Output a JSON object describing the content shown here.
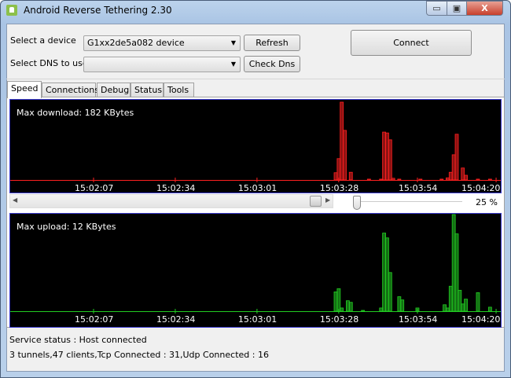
{
  "window": {
    "title": "Android Reverse Tethering 2.30",
    "minimize": "▭",
    "maximize": "▣",
    "close": "X"
  },
  "controls": {
    "device_label": "Select a device",
    "device_value": "G1xx2de5a082  device",
    "refresh": "Refresh",
    "dns_label": "Select DNS to use",
    "dns_value": "",
    "check_dns": "Check Dns",
    "connect": "Connect"
  },
  "tabs": [
    "Speed",
    "Connections",
    "Debug",
    "Status",
    "Tools"
  ],
  "zoom": {
    "value": 25,
    "label": "25 %"
  },
  "colors": {
    "download": "#ff2020",
    "upload": "#22cc22",
    "chart_bg": "#000000",
    "chart_border": "#3a3ad0"
  },
  "chart_data": [
    {
      "type": "bar",
      "title": "Max download: 182 KBytes",
      "ylabel": "KBytes",
      "ymax": 182,
      "x_unit": "seconds after 15:02:07",
      "ticks": [
        "15:02:07",
        "15:02:34",
        "15:03:01",
        "15:03:28",
        "15:03:54",
        "15:04:20"
      ],
      "tick_t": [
        0,
        27,
        54,
        81,
        107,
        133
      ],
      "bars": [
        {
          "t": 80,
          "v": 17
        },
        {
          "t": 81,
          "v": 50
        },
        {
          "t": 82,
          "v": 182
        },
        {
          "t": 83,
          "v": 116
        },
        {
          "t": 85,
          "v": 18
        },
        {
          "t": 91,
          "v": 2
        },
        {
          "t": 95,
          "v": 2
        },
        {
          "t": 96,
          "v": 112
        },
        {
          "t": 97,
          "v": 110
        },
        {
          "t": 98,
          "v": 94
        },
        {
          "t": 99,
          "v": 4
        },
        {
          "t": 101,
          "v": 2
        },
        {
          "t": 108,
          "v": 2
        },
        {
          "t": 115,
          "v": 2
        },
        {
          "t": 117,
          "v": 5
        },
        {
          "t": 118,
          "v": 18
        },
        {
          "t": 119,
          "v": 59
        },
        {
          "t": 120,
          "v": 107
        },
        {
          "t": 122,
          "v": 28
        },
        {
          "t": 123,
          "v": 11
        },
        {
          "t": 127,
          "v": 2
        },
        {
          "t": 131,
          "v": 2
        }
      ]
    },
    {
      "type": "bar",
      "title": "Max upload: 12 KBytes",
      "ylabel": "KBytes",
      "ymax": 12,
      "x_unit": "seconds after 15:02:07",
      "ticks": [
        "15:02:07",
        "15:02:34",
        "15:03:01",
        "15:03:28",
        "15:03:54",
        "15:04:20"
      ],
      "tick_t": [
        0,
        27,
        54,
        81,
        107,
        133
      ],
      "bars": [
        {
          "t": 80,
          "v": 2.4
        },
        {
          "t": 81,
          "v": 2.8
        },
        {
          "t": 82,
          "v": 0.4
        },
        {
          "t": 84,
          "v": 1.3
        },
        {
          "t": 85,
          "v": 1.1
        },
        {
          "t": 89,
          "v": 0.1
        },
        {
          "t": 95,
          "v": 0.4
        },
        {
          "t": 96,
          "v": 9.7
        },
        {
          "t": 97,
          "v": 9.1
        },
        {
          "t": 98,
          "v": 4.8
        },
        {
          "t": 101,
          "v": 1.8
        },
        {
          "t": 102,
          "v": 1.4
        },
        {
          "t": 107,
          "v": 0.4
        },
        {
          "t": 116,
          "v": 0.8
        },
        {
          "t": 117,
          "v": 0.4
        },
        {
          "t": 118,
          "v": 3.1
        },
        {
          "t": 119,
          "v": 12
        },
        {
          "t": 120,
          "v": 9.6
        },
        {
          "t": 121,
          "v": 2.6
        },
        {
          "t": 122,
          "v": 0.9
        },
        {
          "t": 123,
          "v": 1.5
        },
        {
          "t": 127,
          "v": 2.3
        },
        {
          "t": 131,
          "v": 0.5
        }
      ]
    }
  ],
  "status": {
    "service": "Service status : Host connected",
    "summary": "3 tunnels,47 clients,Tcp Connected : 31,Udp Connected : 16"
  }
}
